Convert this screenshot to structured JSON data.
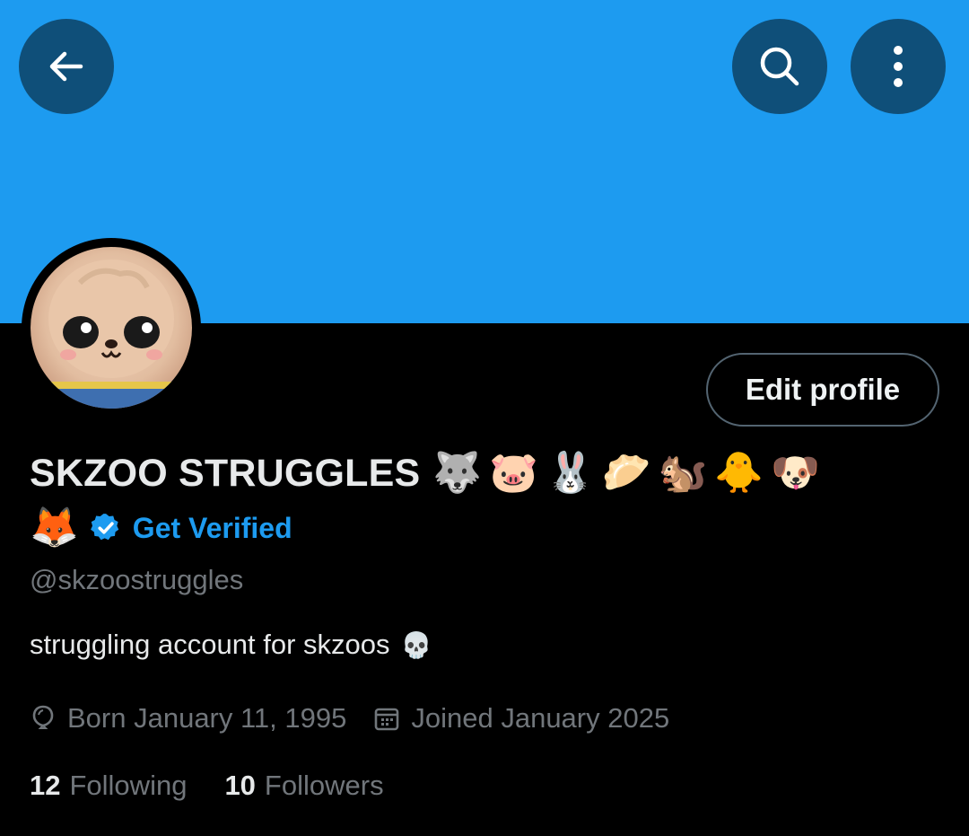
{
  "colors": {
    "banner": "#1d9bf0",
    "button_bg": "#0f4f79",
    "accent": "#1d9bf0",
    "secondary_text": "#71767b"
  },
  "header": {
    "back_icon": "back-arrow-icon",
    "search_icon": "search-icon",
    "more_icon": "more-vertical-icon"
  },
  "profile": {
    "display_name": "SKZOO STRUGGLES",
    "name_emojis": [
      "🐺",
      "🐷",
      "🐰",
      "🥟",
      "🐿️",
      "🐥",
      "🐶"
    ],
    "second_line_emoji": "🦊",
    "verified_badge_icon": "verified-badge-icon",
    "get_verified_label": "Get Verified",
    "handle": "@skzoostruggles",
    "bio": "struggling account for skzoos",
    "bio_emoji": "💀",
    "birthday": "Born January 11, 1995",
    "joined": "Joined January 2025",
    "following_count": "12",
    "following_label": "Following",
    "followers_count": "10",
    "followers_label": "Followers",
    "edit_profile_label": "Edit profile"
  }
}
